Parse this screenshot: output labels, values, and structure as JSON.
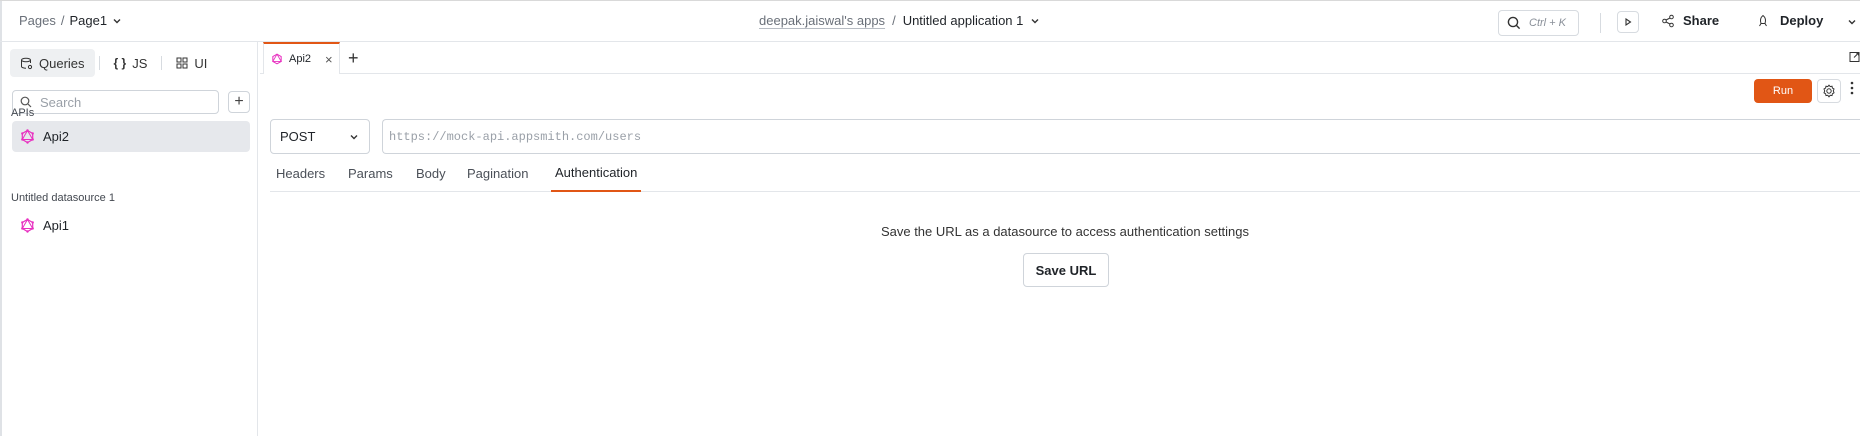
{
  "header": {
    "breadcrumb_pages": "Pages",
    "breadcrumb_sep": "/",
    "current_page": "Page1",
    "workspace": "deepak.jaiswal's apps",
    "app_sep": "/",
    "app_name": "Untitled application 1",
    "search_shortcut": "Ctrl + K",
    "share_label": "Share",
    "deploy_label": "Deploy"
  },
  "sidebar": {
    "tabs": [
      {
        "label": "Queries",
        "icon": "queries-icon"
      },
      {
        "label": "JS",
        "icon": "braces-icon"
      },
      {
        "label": "UI",
        "icon": "widgets-icon"
      }
    ],
    "search_placeholder": "Search",
    "groups": [
      {
        "label": "APIs",
        "items": [
          {
            "label": "Api2",
            "active": true
          }
        ]
      },
      {
        "label": "Untitled datasource 1",
        "items": [
          {
            "label": "Api1",
            "active": false
          }
        ]
      }
    ]
  },
  "editor": {
    "open_tab": "Api2",
    "run_label": "Run",
    "method": "POST",
    "url_placeholder": "https://mock-api.appsmith.com/users",
    "subtabs": [
      "Headers",
      "Params",
      "Body",
      "Pagination",
      "Authentication"
    ],
    "active_subtab": "Authentication",
    "auth_message": "Save the URL as a datasource to access authentication settings",
    "save_url_label": "Save URL"
  },
  "colors": {
    "accent": "#e15615",
    "api_icon": "#e830c0"
  }
}
